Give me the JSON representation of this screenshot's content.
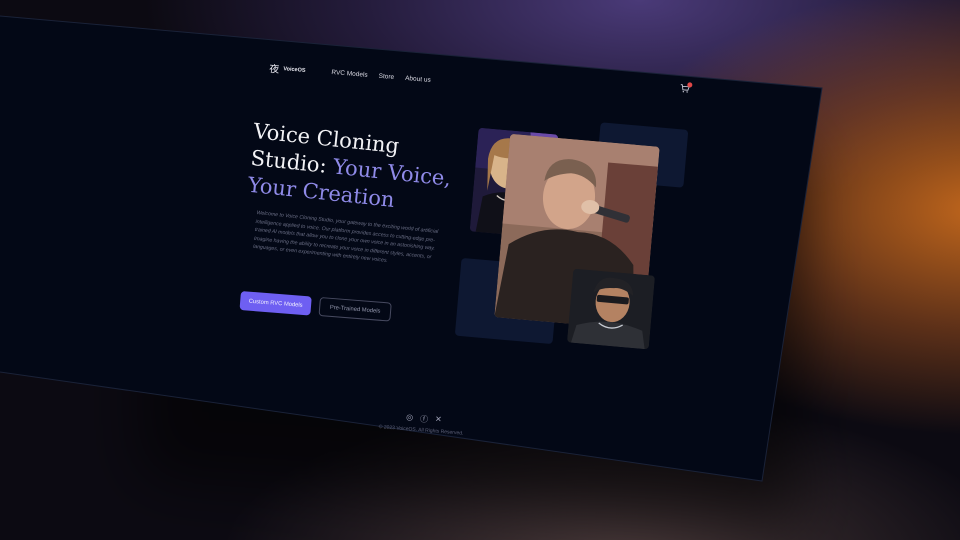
{
  "brand": {
    "logo_glyph": "夜",
    "name": "VoiceOS"
  },
  "nav": {
    "items": [
      {
        "label": "RVC Models"
      },
      {
        "label": "Store"
      },
      {
        "label": "About us"
      }
    ]
  },
  "cart": {
    "icon": "cart-icon",
    "badge_color": "#e04848"
  },
  "hero": {
    "title_line1": "Voice Cloning",
    "title_line2a": "Studio: ",
    "title_line2b": "Your Voice,",
    "title_line3": "Your Creation",
    "description": "Welcome to Voice Cloning Studio, your gateway to the exciting world of artificial intelligence applied to voice. Our platform provides access to cutting-edge pre-trained AI models that allow you to clone your own voice in an astonishing way. Imagine having the ability to recreate your voice in different styles, accents, or languages, or even experimenting with entirely new voices.",
    "primary_button": "Custom RVC Models",
    "secondary_button": "Pre-Trained Models"
  },
  "colors": {
    "accent": "#6e5ff2",
    "accent_text": "#8f8ae8",
    "background": "#030816",
    "panel": "#0e1832"
  },
  "footer": {
    "social": [
      {
        "icon": "instagram-icon",
        "glyph": "◎"
      },
      {
        "icon": "facebook-icon",
        "glyph": "ⓕ"
      },
      {
        "icon": "x-icon",
        "glyph": "✕"
      }
    ],
    "copyright": "© 2023 VoiceOS. All Rights Reserved."
  }
}
